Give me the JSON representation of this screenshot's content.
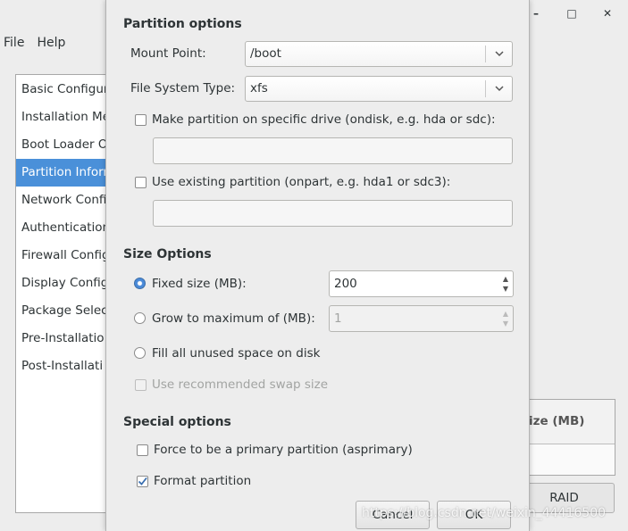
{
  "background": {
    "menu": [
      "File",
      "Help"
    ],
    "window_controls": {
      "minimize": "–",
      "maximize": "□",
      "close": "✕"
    },
    "sidebar_items": [
      "Basic Configura",
      "Installation Me",
      "Boot Loader O",
      "Partition Inforn",
      "Network Confi",
      "Authentication",
      "Firewall Config",
      "Display Configu",
      "Package Selec",
      "Pre-Installatio",
      "Post-Installati"
    ],
    "selected_sidebar_index": 3,
    "table_header": "ize (MB)",
    "raid_button": "RAID"
  },
  "dialog": {
    "partition_options": {
      "title": "Partition options",
      "mount_point_label": "Mount Point:",
      "mount_point_value": "/boot",
      "fs_type_label": "File System Type:",
      "fs_type_value": "xfs",
      "ondisk_label": "Make partition on specific drive (ondisk, e.g. hda or sdc):",
      "ondisk_checked": false,
      "onpart_label": "Use existing partition (onpart, e.g. hda1 or sdc3):",
      "onpart_checked": false
    },
    "size_options": {
      "title": "Size Options",
      "fixed_label": "Fixed size (MB):",
      "fixed_value": "200",
      "grow_label": "Grow to maximum of (MB):",
      "grow_value": "1",
      "fill_label": "Fill all unused space on disk",
      "swap_label": "Use recommended swap size",
      "selected": "fixed"
    },
    "special_options": {
      "title": "Special options",
      "primary_label": "Force to be a primary partition (asprimary)",
      "primary_checked": false,
      "format_label": "Format partition",
      "format_checked": true
    },
    "buttons": {
      "cancel": "Cancel",
      "ok": "OK"
    }
  },
  "watermark": "https://blog.csdn.net/weixin_44416500"
}
